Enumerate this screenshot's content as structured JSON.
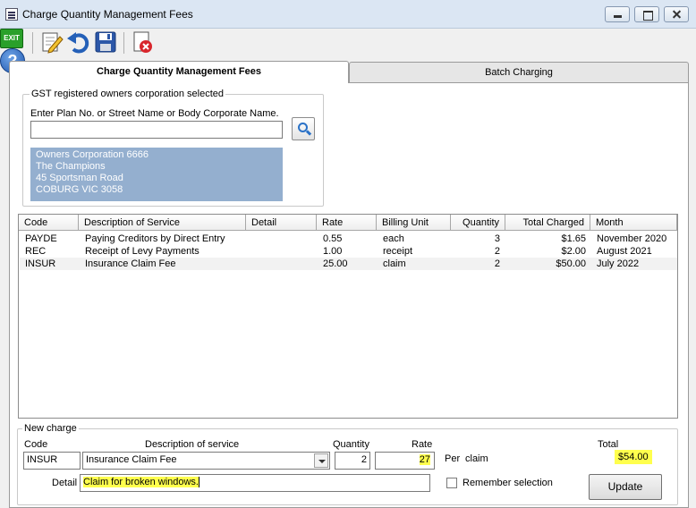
{
  "window": {
    "title": "Charge Quantity Management Fees"
  },
  "toolbar": {
    "exit_label": "EXIT",
    "help_label": "?"
  },
  "tabs": [
    {
      "label": "Charge Quantity Management Fees",
      "active": true
    },
    {
      "label": "Batch Charging",
      "active": false
    }
  ],
  "owner_group": {
    "legend": "GST registered owners corporation selected",
    "search_label": "Enter Plan No. or Street Name or Body Corporate Name.",
    "search_value": "",
    "address_lines": [
      "Owners Corporation 6666",
      "The Champions",
      "45 Sportsman Road",
      "COBURG  VIC  3058"
    ]
  },
  "table": {
    "columns": [
      "Code",
      "Description of Service",
      "Detail",
      "Rate",
      "Billing Unit",
      "Quantity",
      "Total Charged",
      "Month"
    ],
    "rows": [
      [
        "PAYDE",
        "Paying Creditors by Direct Entry",
        "",
        "0.55",
        "each",
        "3",
        "$1.65",
        "November 2020"
      ],
      [
        "REC",
        "Receipt of Levy Payments",
        "",
        "1.00",
        "receipt",
        "2",
        "$2.00",
        "August 2021"
      ],
      [
        "INSUR",
        "Insurance Claim Fee",
        "",
        "25.00",
        "claim",
        "2",
        "$50.00",
        "July 2022"
      ]
    ]
  },
  "new_charge": {
    "legend": "New charge",
    "code_label": "Code",
    "code_value": "INSUR",
    "desc_label": "Description of service",
    "desc_value": "Insurance Claim Fee",
    "qty_label": "Quantity",
    "qty_value": "2",
    "rate_label": "Rate",
    "rate_value": "27",
    "per_label": "Per",
    "per_unit": "claim",
    "total_label": "Total",
    "total_value": "$54.00",
    "detail_label": "Detail",
    "detail_value": "Claim for broken windows.",
    "remember_label": "Remember selection",
    "remember_checked": false,
    "update_label": "Update"
  },
  "colors": {
    "address_bg": "#94afcf",
    "highlight": "#ffff4d",
    "exit_green": "#2aa02a"
  }
}
